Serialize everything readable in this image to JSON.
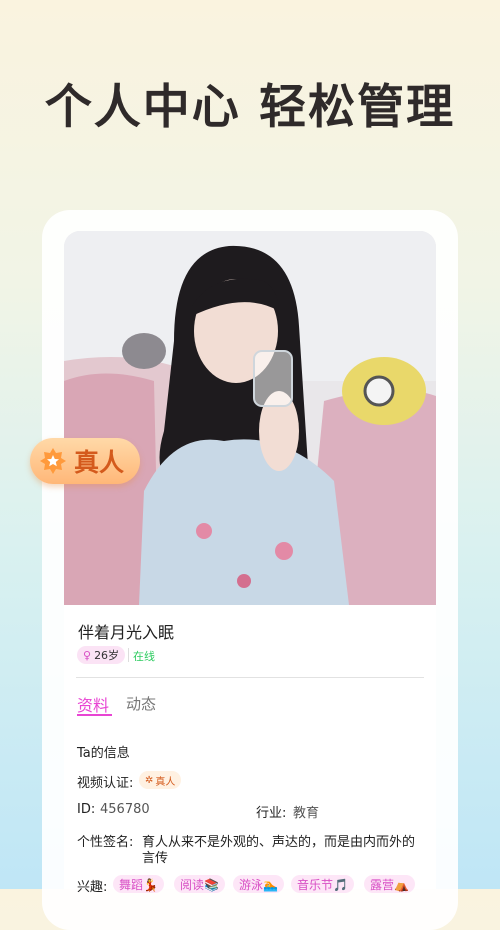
{
  "headline": "个人中心 轻松管理",
  "real_badge": {
    "label": "真人",
    "icon": "verified-star-icon"
  },
  "profile": {
    "name": "伴着月光入眠",
    "gender_symbol": "♀",
    "age": "26岁",
    "status": "在线"
  },
  "tabs": [
    {
      "label": "资料",
      "active": true
    },
    {
      "label": "动态",
      "active": false
    }
  ],
  "section_title": "Ta的信息",
  "video_verify": {
    "label": "视频认证:",
    "badge": "真人"
  },
  "id": {
    "label": "ID:",
    "value": "456780"
  },
  "industry": {
    "label": "行业:",
    "value": "教育"
  },
  "signature": {
    "label": "个性签名:",
    "line1": "育人从来不是外观的、声达的，而是由内而外的",
    "line2": "言传"
  },
  "interests": {
    "label": "兴趣:",
    "tags": [
      "舞蹈💃",
      "阅读📚",
      "游泳🏊",
      "音乐节🎵",
      "露营⛺"
    ]
  },
  "colors": {
    "accent": "#e845d3",
    "online": "#2fcc61",
    "badge_orange": "#d45a1c"
  }
}
